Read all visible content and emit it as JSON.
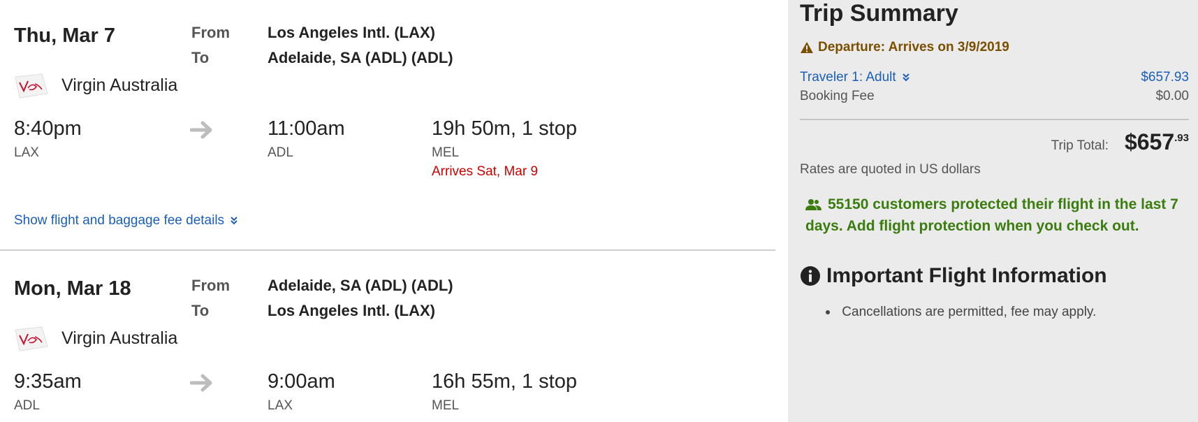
{
  "flights": [
    {
      "date": "Thu, Mar 7",
      "from_label": "From",
      "to_label": "To",
      "from": "Los Angeles Intl. (LAX)",
      "to": "Adelaide, SA (ADL) (ADL)",
      "airline": "Virgin Australia",
      "depart_time": "8:40pm",
      "depart_code": "LAX",
      "arrive_time": "11:00am",
      "arrive_code": "ADL",
      "duration": "19h 50m, 1 stop",
      "stop_code": "MEL",
      "arrives_note": "Arrives Sat, Mar 9",
      "details_link": "Show flight and baggage fee details"
    },
    {
      "date": "Mon, Mar 18",
      "from_label": "From",
      "to_label": "To",
      "from": "Adelaide, SA (ADL) (ADL)",
      "to": "Los Angeles Intl. (LAX)",
      "airline": "Virgin Australia",
      "depart_time": "9:35am",
      "depart_code": "ADL",
      "arrive_time": "9:00am",
      "arrive_code": "LAX",
      "duration": "16h 55m, 1 stop",
      "stop_code": "MEL"
    }
  ],
  "summary": {
    "title": "Trip Summary",
    "warning": "Departure: Arrives on 3/9/2019",
    "traveler_label": "Traveler 1: Adult",
    "traveler_amount": "$657.93",
    "fee_label": "Booking Fee",
    "fee_amount": "$0.00",
    "total_label": "Trip Total:",
    "total_dollars": "$657",
    "total_cents": ".93",
    "rates_note": "Rates are quoted in US dollars",
    "protection_note": "55150 customers protected their flight in the last 7 days. Add flight protection when you check out.",
    "info_title": "Important Flight Information",
    "info_items": [
      "Cancellations are permitted, fee may apply."
    ]
  },
  "colors": {
    "link": "#1b5eb6",
    "warning": "#7a4f00",
    "alert_red": "#cc0000",
    "protection_green": "#3a7d0e",
    "sidebar_bg": "#ebebeb"
  },
  "icons": [
    "virgin-logo-icon",
    "arrow-right-icon",
    "chevron-double-down-icon",
    "warning-triangle-icon",
    "users-icon",
    "info-circle-icon"
  ]
}
